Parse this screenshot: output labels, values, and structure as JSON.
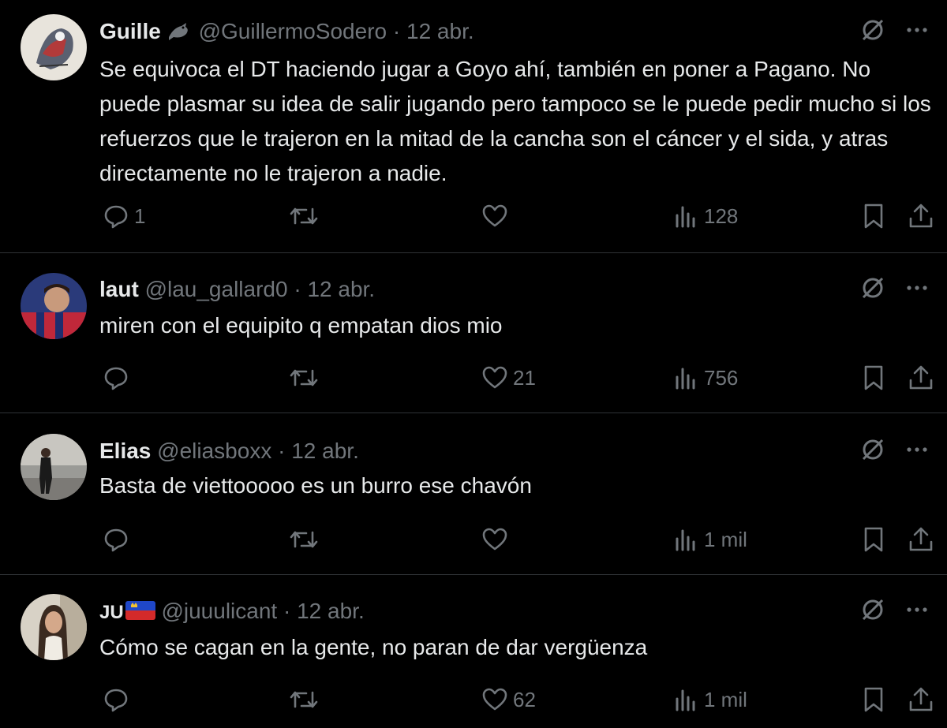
{
  "tweets": [
    {
      "name": "Guille",
      "has_bird_badge": true,
      "handle": "@GuillermoSodero",
      "separator": "·",
      "date": "12 abr.",
      "text": "Se equivoca el DT haciendo jugar a Goyo ahí, también en poner a Pagano. No puede plasmar su idea de salir jugando pero tampoco se le puede pedir mucho si los refuerzos que le trajeron en la mitad de la cancha son el cáncer y el sida, y atras directamente no le trajeron a nadie.",
      "replies": "1",
      "retweets": "",
      "likes": "",
      "views": "128"
    },
    {
      "name": "laut",
      "handle": "@lau_gallard0",
      "separator": "·",
      "date": "12 abr.",
      "text": "miren con el equipito q empatan dios mio",
      "replies": "",
      "retweets": "",
      "likes": "21",
      "views": "756"
    },
    {
      "name": "Elias",
      "handle": "@eliasboxx",
      "separator": "·",
      "date": "12 abr.",
      "text": "Basta de viettooooo es un burro ese chavón",
      "replies": "",
      "retweets": "",
      "likes": "",
      "views": "1 mil"
    },
    {
      "name": "JU",
      "flag": "flag-icon",
      "handle": "@juuulicant",
      "separator": "·",
      "date": "12 abr.",
      "text": "Cómo se cagan en la gente, no paran de dar vergüenza",
      "replies": "",
      "retweets": "",
      "likes": "62",
      "views": "1 mil"
    }
  ],
  "colors": {
    "background": "#000000",
    "text": "#e7e9ea",
    "muted": "#71767b",
    "divider": "#2f3336"
  }
}
